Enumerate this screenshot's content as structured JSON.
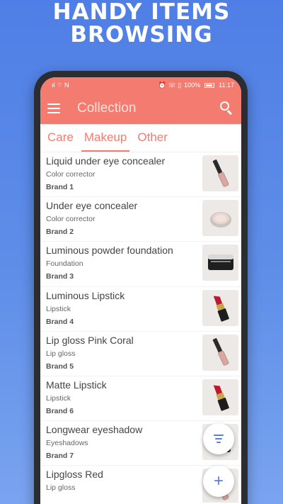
{
  "headline": {
    "line1": "HANDY ITEMS",
    "line2": "BROWSING"
  },
  "status": {
    "left": "ıl ⌔ N",
    "right_icons": "⏰ ☏ ▯",
    "battery": "100%",
    "time": "11:17"
  },
  "appbar": {
    "title": "Collection",
    "menu_icon": "menu-icon",
    "search_icon": "search-icon"
  },
  "tabs": [
    {
      "label": "Care",
      "active": false
    },
    {
      "label": "Makeup",
      "active": true
    },
    {
      "label": "Other",
      "active": false
    }
  ],
  "items": [
    {
      "name": "Liquid under eye concealer",
      "category": "Color corrector",
      "brand": "Brand 1",
      "thumb": "lipgloss"
    },
    {
      "name": "Under eye concealer",
      "category": "Color corrector",
      "brand": "Brand 2",
      "thumb": "pot"
    },
    {
      "name": "Luminous powder foundation",
      "category": "Foundation",
      "brand": "Brand 3",
      "thumb": "jar"
    },
    {
      "name": "Luminous Lipstick",
      "category": "Lipstick",
      "brand": "Brand 4",
      "thumb": "lipstick"
    },
    {
      "name": "Lip gloss Pink Coral",
      "category": "Lip gloss",
      "brand": "Brand 5",
      "thumb": "lipgloss"
    },
    {
      "name": "Matte Lipstick",
      "category": "Lipstick",
      "brand": "Brand 6",
      "thumb": "lipstick"
    },
    {
      "name": "Longwear eyeshadow",
      "category": "Eyeshadows",
      "brand": "Brand 7",
      "thumb": "compact"
    },
    {
      "name": "Lipgloss Red",
      "category": "Lip gloss",
      "brand": "",
      "thumb": "lipgloss"
    }
  ],
  "fabs": {
    "filter_icon": "filter-icon",
    "add_label": "+"
  },
  "bottom_nav": [
    {
      "icon": "list-icon",
      "glyph": "☰",
      "active": true
    },
    {
      "icon": "collections-icon",
      "glyph": "▢",
      "active": false
    },
    {
      "icon": "stats-icon",
      "glyph": "◔",
      "active": false
    },
    {
      "icon": "favorites-icon",
      "glyph": "♥",
      "active": false
    }
  ],
  "colors": {
    "accent": "#f47b6f",
    "fab_icon": "#5b7fd6",
    "background": "#5f8ee8"
  }
}
